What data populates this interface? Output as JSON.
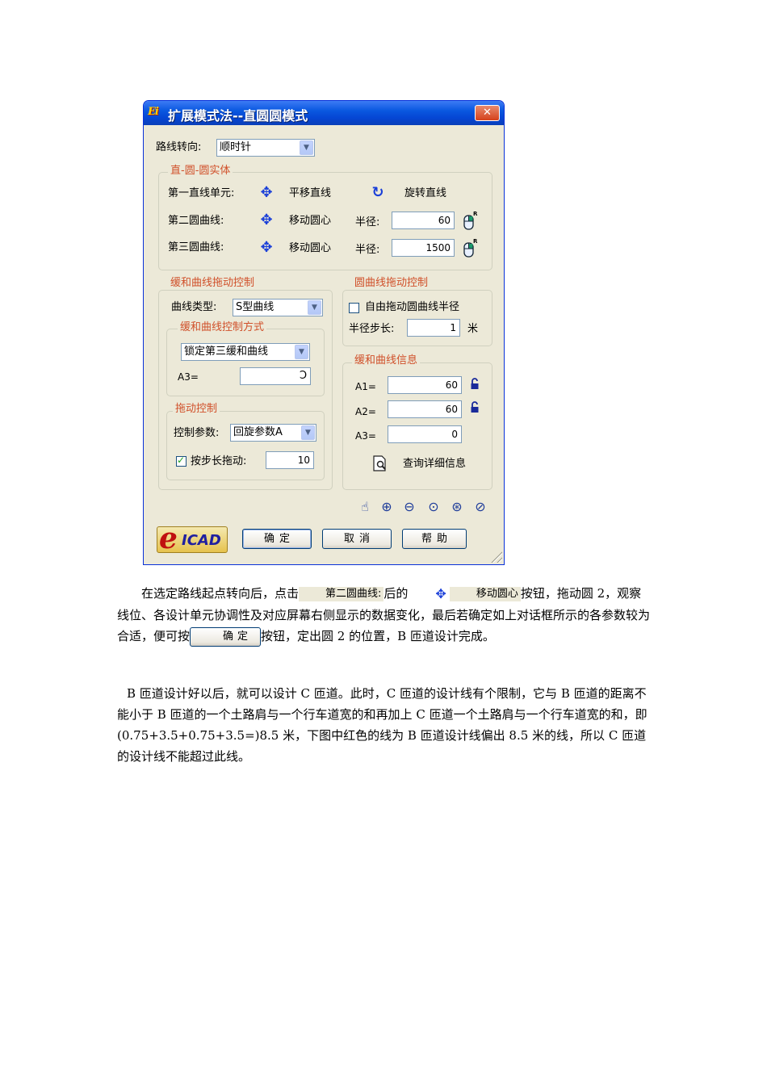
{
  "dialog": {
    "title": "扩展模式法--直圆圆模式",
    "app_icon_text": "Ei",
    "close_symbol": "✕",
    "route_direction": {
      "label": "路线转向:",
      "value": "顺时针"
    },
    "solid_group": {
      "legend": "直-圆-圆实体",
      "row1": {
        "label": "第一直线单元:",
        "action1": "平移直线",
        "action2": "旋转直线"
      },
      "row2": {
        "label": "第二圆曲线:",
        "action": "移动圆心",
        "radius_label": "半径:",
        "radius_value": "60"
      },
      "row3": {
        "label": "第三圆曲线:",
        "action": "移动圆心",
        "radius_label": "半径:",
        "radius_value": "1500"
      }
    },
    "easement_drag": {
      "legend": "缓和曲线拖动控制",
      "curve_type": {
        "label": "曲线类型:",
        "value": "S型曲线"
      },
      "control_mode": {
        "legend": "缓和曲线控制方式",
        "value": "锁定第三缓和曲线",
        "a3_label": "A3=",
        "a3_value": ""
      }
    },
    "drag_control": {
      "legend": "拖动控制",
      "param_label": "控制参数:",
      "param_value": "回旋参数A",
      "step_checkbox_label": "按步长拖动:",
      "step_value": "10"
    },
    "circle_drag": {
      "legend": "圆曲线拖动控制",
      "free_radius_label": "自由拖动圆曲线半径",
      "step_label": "半径步长:",
      "step_value": "1",
      "step_unit": "米"
    },
    "easement_info": {
      "legend": "缓和曲线信息",
      "a1_label": "A1=",
      "a1_value": "60",
      "a2_label": "A2=",
      "a2_value": "60",
      "a3_label": "A3=",
      "a3_value": "0",
      "query_label": "查询详细信息"
    },
    "buttons": {
      "ok": "确定",
      "cancel": "取消",
      "help": "帮助"
    },
    "logo_text": "ICAD",
    "logo_e": "e"
  },
  "text": {
    "p1_a": "在选定路线起点转向后，点击",
    "p1_chip1": "第二圆曲线:",
    "p1_b": "后的",
    "p1_chip2": "移动圆心",
    "p1_c": "按钮，拖动圆 2，观察线位、各设计单元协调性及对应屏幕右侧显示的数据变化，最后若确定如上对话框所示的各参数较为合适，便可按",
    "p1_btn": "确定",
    "p1_d": "按钮，定出圆 2 的位置，B 匝道设计完成。",
    "p2": "B 匝道设计好以后，就可以设计 C 匝道。此时，C 匝道的设计线有个限制，它与 B 匝道的距离不能小于 B 匝道的一个土路肩与一个行车道宽的和再加上 C 匝道一个土路肩与一个行车道宽的和，即(0.75+3.5+0.75+3.5=)8.5 米，下图中红色的线为 B 匝道设计线偏出 8.5 米的线，所以 C 匝道的设计线不能超过此线。"
  }
}
